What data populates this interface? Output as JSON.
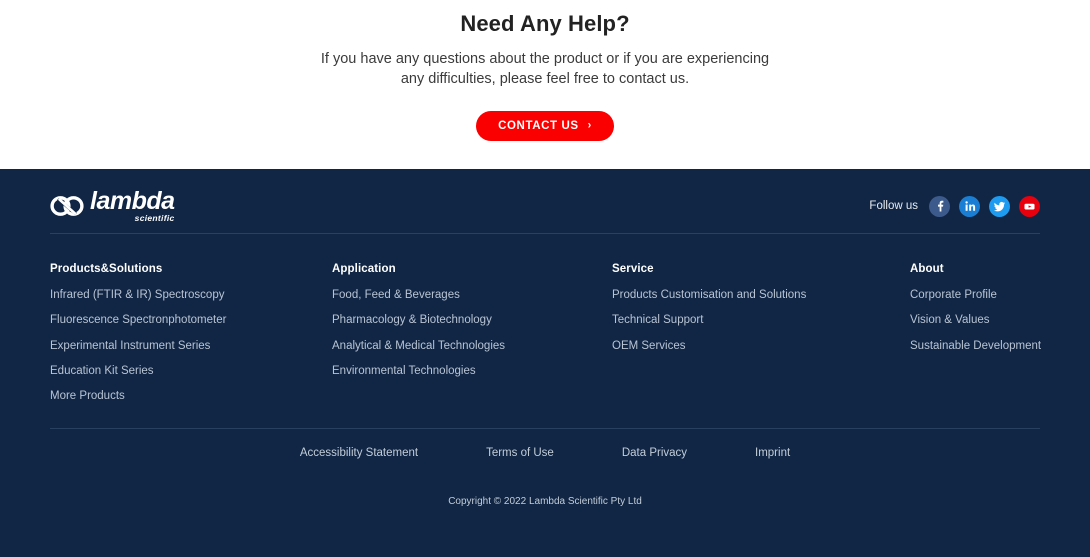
{
  "help": {
    "title": "Need Any Help?",
    "subtitle": "If you have any questions about the product or if you are experiencing any difficulties, please feel free to contact us.",
    "cta_label": "CONTACT US",
    "cta_chevron": "›",
    "cta_color": "#fa0000"
  },
  "footer": {
    "background_color": "#102644",
    "logo": {
      "mark": "infinity-lambda-mark",
      "word": "lambda",
      "sub": "scientific"
    },
    "follow": {
      "label": "Follow us",
      "socials": [
        {
          "name": "facebook-icon",
          "label": "Facebook",
          "color": "#3d5a8c"
        },
        {
          "name": "linkedin-icon",
          "label": "LinkedIn",
          "color": "#1a7fd4"
        },
        {
          "name": "twitter-icon",
          "label": "Twitter",
          "color": "#1d9bf0"
        },
        {
          "name": "youtube-icon",
          "label": "YouTube",
          "color": "#e8000d"
        }
      ]
    },
    "columns": [
      {
        "heading": "Products&Solutions",
        "links": [
          "Infrared (FTIR & IR) Spectroscopy",
          "Fluorescence Spectronphotometer",
          "Experimental Instrument Series",
          "Education Kit Series",
          "More Products"
        ]
      },
      {
        "heading": "Application",
        "links": [
          "Food, Feed & Beverages",
          "Pharmacology & Biotechnology",
          "Analytical & Medical Technologies",
          "Environmental Technologies"
        ]
      },
      {
        "heading": "Service",
        "links": [
          "Products Customisation and Solutions",
          "Technical Support",
          "OEM Services"
        ]
      },
      {
        "heading": "About",
        "links": [
          "Corporate Profile",
          "Vision & Values",
          "Sustainable Development"
        ]
      }
    ],
    "bottom_links": [
      "Accessibility Statement",
      "Terms of Use",
      "Data Privacy",
      "Imprint"
    ],
    "copyright": "Copyright © 2022 Lambda Scientific Pty Ltd"
  }
}
